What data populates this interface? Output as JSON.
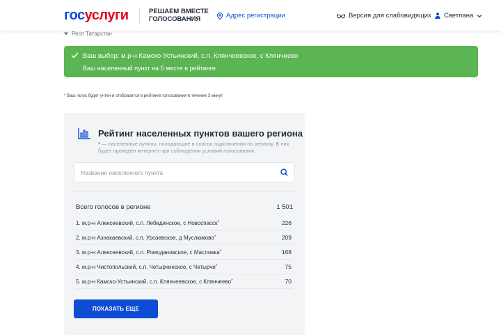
{
  "header": {
    "logo_part1": "гос",
    "logo_part2": "услуги",
    "campaign_line1": "РЕШАЕМ ВМЕСТЕ",
    "campaign_line2": "ГОЛОСОВАНИЯ",
    "address_link": "Адрес регистрации",
    "vision_link": "Версия для слабовидящих",
    "user_name": "Светлана"
  },
  "region": {
    "name": "Респ Татарстан"
  },
  "success_banner": {
    "line1": "Ваш выбор: м.р-н Камско-Устьинский, с.п. Клянчеевское, с Клянчеево",
    "line2": "Ваш населенный пункт на 5 месте в рейтинге"
  },
  "footnote": "* Ваш голос будет учтен и отобразится в рейтинге голосования в течение 3 минут",
  "rating": {
    "title": "Рейтинг населенных пунктов вашего региона",
    "note_star": "*",
    "note_text": " — населенные пункты, попадающие в список подключения по региону. В них будет проведен интернет при соблюдении условий голосования.",
    "search_placeholder": "Название населенного пункта",
    "total_label": "Всего голосов в регионе",
    "total_value": "1 501",
    "items": [
      {
        "label": "1. м.р-н Алексеевский, с.п. Лебединское, с Новоспасск",
        "star": "*",
        "votes": "226"
      },
      {
        "label": "2. м.р-н Азнакаевский, с.п. Урсаевское, д Муслюмово",
        "star": "*",
        "votes": "209"
      },
      {
        "label": "3. м.р-н Алексеевский, с.п. Ромодановское, с Масловка",
        "star": "*",
        "votes": "168"
      },
      {
        "label": "4. м.р-н Чистопольский, с.п. Четырчинское, с Четырчи",
        "star": "*",
        "votes": "75"
      },
      {
        "label": "5. м.р-н Камско-Устьинский, с.п. Клянчеевское, с Клянчеево",
        "star": "*",
        "votes": "70"
      }
    ],
    "more_button": "ПОКАЗАТЬ ЕЩЕ"
  },
  "colors": {
    "brand_blue": "#0d4cd3",
    "brand_red": "#e1061d",
    "success_green": "#5ab552"
  },
  "icons": [
    "location-pin-icon",
    "glasses-icon",
    "user-icon",
    "chevron-down-icon",
    "check-icon",
    "bar-chart-icon",
    "search-icon",
    "triangle-down-icon"
  ]
}
